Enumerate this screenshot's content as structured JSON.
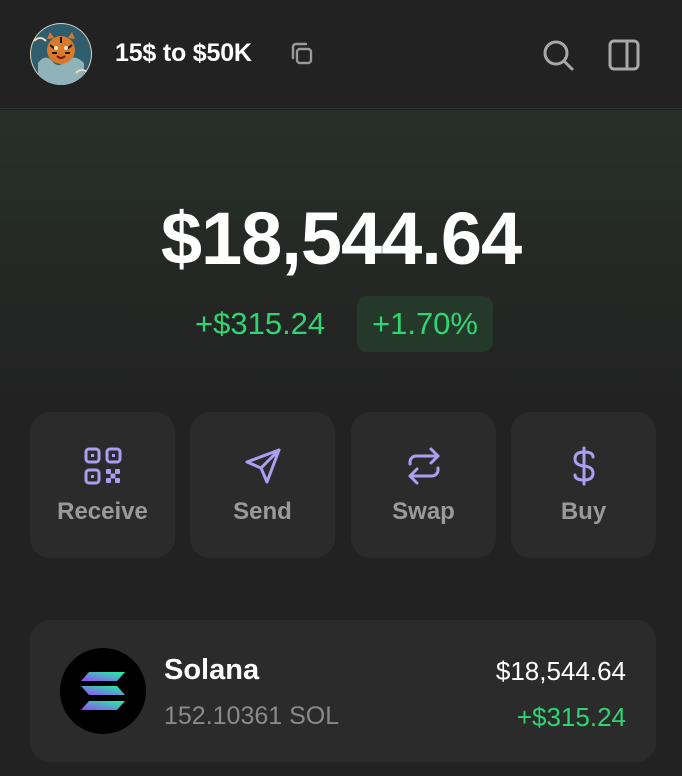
{
  "header": {
    "account_name": "15$ to $50K",
    "avatar_icon": "tiger-avatar",
    "copy_icon": "copy-icon",
    "search_icon": "search-icon",
    "panel_icon": "side-panel-icon"
  },
  "portfolio": {
    "balance": "$18,544.64",
    "change_amount": "+$315.24",
    "change_percent": "+1.70%"
  },
  "actions": [
    {
      "label": "Receive",
      "icon": "qr-code-icon"
    },
    {
      "label": "Send",
      "icon": "paper-plane-icon"
    },
    {
      "label": "Swap",
      "icon": "swap-arrows-icon"
    },
    {
      "label": "Buy",
      "icon": "dollar-icon"
    }
  ],
  "tokens": [
    {
      "name": "Solana",
      "amount": "152.10361 SOL",
      "value": "$18,544.64",
      "change": "+$315.24",
      "icon": "solana-logo-icon"
    }
  ],
  "colors": {
    "background": "#222222",
    "accent_purple": "#ab9ff2",
    "positive_green": "#2ed672",
    "card": "#2b2b2b"
  }
}
